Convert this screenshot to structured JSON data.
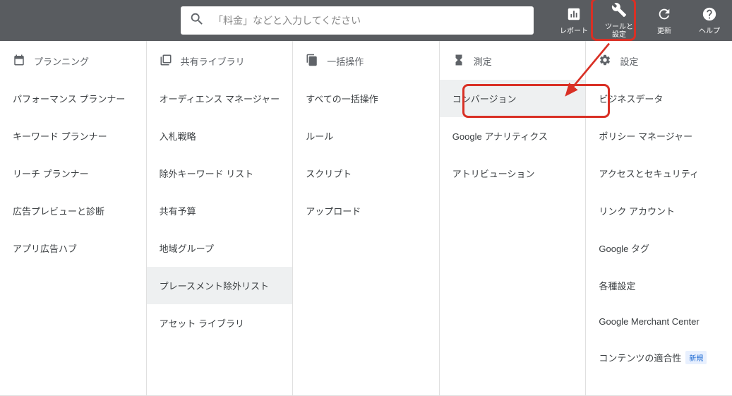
{
  "search": {
    "placeholder": "「料金」などと入力してください"
  },
  "topbar": {
    "report": "レポート",
    "tools": "ツールと\n設定",
    "refresh": "更新",
    "help": "ヘルプ"
  },
  "columns": {
    "planning": {
      "header": "プランニング",
      "items": [
        "パフォーマンス プランナー",
        "キーワード プランナー",
        "リーチ プランナー",
        "広告プレビューと診断",
        "アプリ広告ハブ"
      ]
    },
    "library": {
      "header": "共有ライブラリ",
      "items": [
        "オーディエンス マネージャー",
        "入札戦略",
        "除外キーワード リスト",
        "共有予算",
        "地域グループ",
        "プレースメント除外リスト",
        "アセット ライブラリ"
      ]
    },
    "bulk": {
      "header": "一括操作",
      "items": [
        "すべての一括操作",
        "ルール",
        "スクリプト",
        "アップロード"
      ]
    },
    "measure": {
      "header": "測定",
      "items": [
        "コンバージョン",
        "Google アナリティクス",
        "アトリビューション"
      ]
    },
    "settings": {
      "header": "設定",
      "items": [
        "ビジネスデータ",
        "ポリシー マネージャー",
        "アクセスとセキュリティ",
        "リンク アカウント",
        "Google タグ",
        "各種設定",
        "Google Merchant Center",
        "コンテンツの適合性"
      ],
      "badge_new": "新規"
    }
  }
}
